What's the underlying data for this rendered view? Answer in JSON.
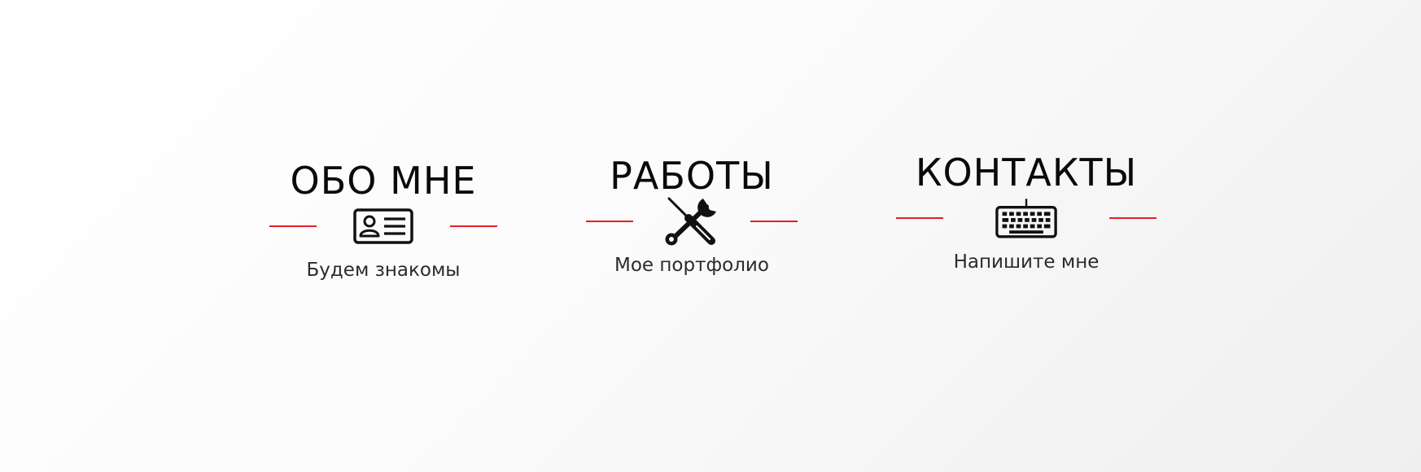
{
  "nav_cards": [
    {
      "title": "ОБО МНЕ",
      "subtitle": "Будем знакомы",
      "icon": "id-card-icon"
    },
    {
      "title": "РАБОТЫ",
      "subtitle": "Мое портфолио",
      "icon": "tools-icon"
    },
    {
      "title": "КОНТАКТЫ",
      "subtitle": "Напишите мне",
      "icon": "keyboard-icon"
    }
  ],
  "colors": {
    "accent_line": "#e41f26",
    "text": "#111111",
    "background": "#f7f7f7"
  }
}
